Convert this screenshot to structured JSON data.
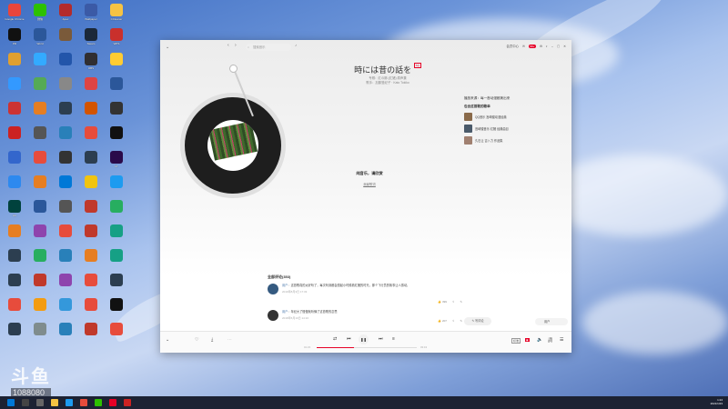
{
  "desktop": {
    "icons": [
      {
        "label": "Google Chrome",
        "color": "#e8453c"
      },
      {
        "label": "微信",
        "color": "#2dc100"
      },
      {
        "label": "Apex",
        "color": "#b32b2b"
      },
      {
        "label": "Wallpaper",
        "color": "#3b5aa6"
      },
      {
        "label": "CCleaner",
        "color": "#f6c343"
      },
      {
        "label": "PR",
        "color": "#111111"
      },
      {
        "label": "Word",
        "color": "#2b579a"
      },
      {
        "label": "",
        "color": "#7a5a3a"
      },
      {
        "label": "Steam",
        "color": "#1b2838"
      },
      {
        "label": "WPS",
        "color": "#c9302c"
      },
      {
        "label": "",
        "color": "#e0a030"
      },
      {
        "label": "",
        "color": "#33aaff"
      },
      {
        "label": "",
        "color": "#2255aa"
      },
      {
        "label": "OBS",
        "color": "#302e31"
      },
      {
        "label": "",
        "color": "#ffcc33"
      },
      {
        "label": "",
        "color": "#3399ff"
      },
      {
        "label": "",
        "color": "#55aa55"
      },
      {
        "label": "",
        "color": "#888888"
      },
      {
        "label": "",
        "color": "#dd4444"
      },
      {
        "label": "",
        "color": "#2b579a"
      },
      {
        "label": "",
        "color": "#cc3333"
      },
      {
        "label": "",
        "color": "#e67e22"
      },
      {
        "label": "",
        "color": "#2c3e50"
      },
      {
        "label": "",
        "color": "#d35400"
      },
      {
        "label": "",
        "color": "#333333"
      },
      {
        "label": "",
        "color": "#cc2222"
      },
      {
        "label": "",
        "color": "#555555"
      },
      {
        "label": "",
        "color": "#2980b9"
      },
      {
        "label": "",
        "color": "#e74c3c"
      },
      {
        "label": "",
        "color": "#111111"
      },
      {
        "label": "",
        "color": "#3366cc"
      },
      {
        "label": "",
        "color": "#e74c3c"
      },
      {
        "label": "",
        "color": "#333333"
      },
      {
        "label": "",
        "color": "#2c3e50"
      },
      {
        "label": "Pr",
        "color": "#2a0a4a"
      },
      {
        "label": "",
        "color": "#2d89ef"
      },
      {
        "label": "",
        "color": "#e67e22"
      },
      {
        "label": "",
        "color": "#0078d7"
      },
      {
        "label": "",
        "color": "#f1c40f"
      },
      {
        "label": "",
        "color": "#1d9bf0"
      },
      {
        "label": "Au",
        "color": "#00423d"
      },
      {
        "label": "",
        "color": "#2b579a"
      },
      {
        "label": "",
        "color": "#555555"
      },
      {
        "label": "",
        "color": "#c0392b"
      },
      {
        "label": "",
        "color": "#27ae60"
      },
      {
        "label": "",
        "color": "#e67e22"
      },
      {
        "label": "",
        "color": "#8e44ad"
      },
      {
        "label": "",
        "color": "#e74c3c"
      },
      {
        "label": "",
        "color": "#c0392b"
      },
      {
        "label": "",
        "color": "#16a085"
      },
      {
        "label": "",
        "color": "#2c3e50"
      },
      {
        "label": "",
        "color": "#27ae60"
      },
      {
        "label": "",
        "color": "#2980b9"
      },
      {
        "label": "",
        "color": "#e67e22"
      },
      {
        "label": "",
        "color": "#16a085"
      },
      {
        "label": "",
        "color": "#2c3e50"
      },
      {
        "label": "",
        "color": "#c0392b"
      },
      {
        "label": "",
        "color": "#8e44ad"
      },
      {
        "label": "",
        "color": "#e74c3c"
      },
      {
        "label": "",
        "color": "#2c3e50"
      },
      {
        "label": "",
        "color": "#e74c3c"
      },
      {
        "label": "",
        "color": "#f39c12"
      },
      {
        "label": "",
        "color": "#3498db"
      },
      {
        "label": "",
        "color": "#e74c3c"
      },
      {
        "label": "",
        "color": "#111111"
      },
      {
        "label": "",
        "color": "#2c3e50"
      },
      {
        "label": "",
        "color": "#7f8c8d"
      },
      {
        "label": "",
        "color": "#2980b9"
      },
      {
        "label": "",
        "color": "#c0392b"
      },
      {
        "label": "",
        "color": "#e74c3c"
      }
    ],
    "watermark_big": "斗鱼",
    "watermark_num": "1088080"
  },
  "window": {
    "search_placeholder": "搜索音乐",
    "vip_label": "会员中心",
    "badge": "99+",
    "accent": "#e60026"
  },
  "song": {
    "title": "時には昔の話を",
    "tag": "SQ",
    "subtitle_1": "专辑：红の豚 (红猪) 原声集",
    "subtitle_2": "歌手：加藤登紀子 · Kato Tokiko"
  },
  "lyrics": {
    "main": "纯音乐，请欣赏",
    "link": "贡献歌词"
  },
  "side_panel": {
    "title": "播放来源：每一首动漫都美出来",
    "sub": "包含这首歌的歌单",
    "items": [
      {
        "label": "QQ音乐 宫崎骏动漫经典"
      },
      {
        "label": "宫崎骏音乐 红猪 经典曲目"
      },
      {
        "label": "久石让 吉卜力 作品集"
      }
    ]
  },
  "comments": {
    "header": "全部评论(353)",
    "items": [
      {
        "user": "用户",
        "text": "这首歌真的太好听了，每次听到都会想起小时候看红猪的时光，那个飞行员的故事让人感动。",
        "time": "2019年8月3日 17:33",
        "likes": "399"
      },
      {
        "user": "用户",
        "text": "年纪大了慢慢就听懂了这首歌的意思",
        "time": "2018年5月19日 14:16",
        "likes": "207"
      }
    ],
    "write_label": "写评论",
    "user_label": "用户"
  },
  "player": {
    "time_current": "01:23",
    "time_total": "03:43",
    "progress": 0.37,
    "quality": "标准",
    "play_icon": "pause-icon"
  },
  "taskbar": {
    "time": "1:24",
    "date": "2021/1/23"
  }
}
